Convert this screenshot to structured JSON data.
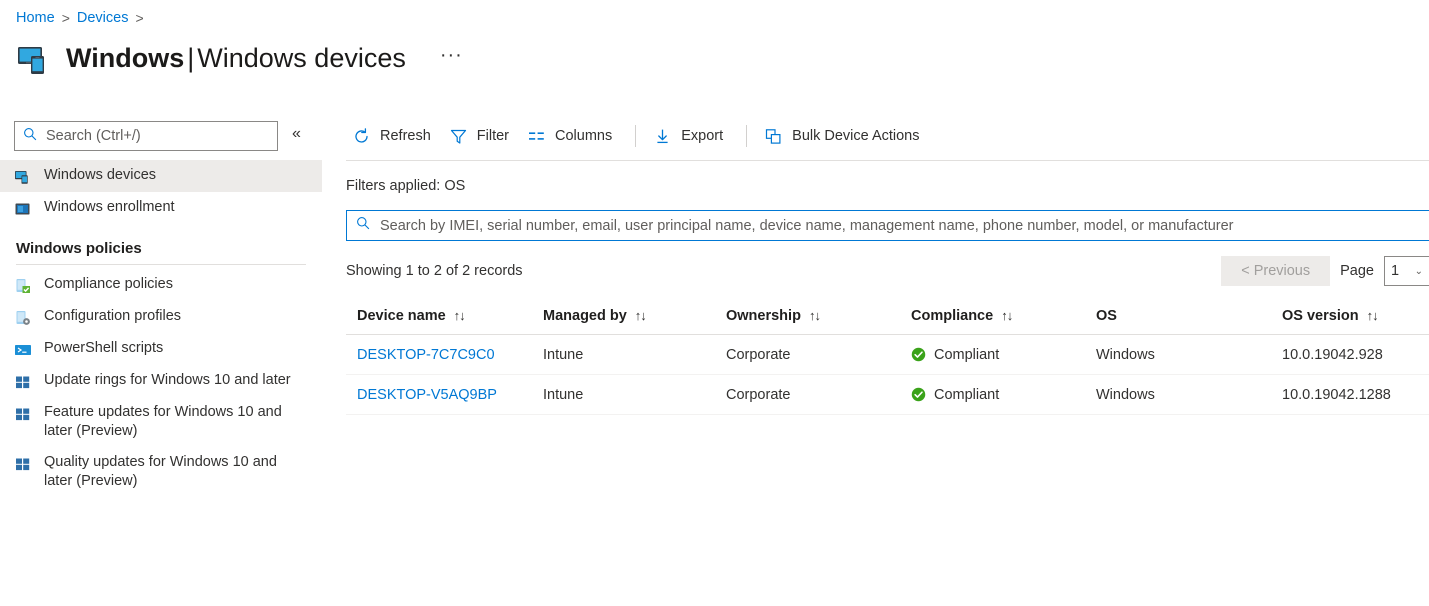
{
  "breadcrumb": {
    "items": [
      "Home",
      "Devices"
    ],
    "separator": ">"
  },
  "header": {
    "title_bold": "Windows",
    "title_separator": "|",
    "title_light": "Windows devices",
    "ellipsis": "···",
    "icon": "windows-devices-icon"
  },
  "sidebar": {
    "search": {
      "placeholder": "Search (Ctrl+/)",
      "value": "",
      "icon": "search-icon"
    },
    "collapse": {
      "icon": "chevron-double-left-icon",
      "glyph": "«"
    },
    "items": [
      {
        "label": "Windows devices",
        "icon": "windows-devices-icon",
        "selected": true
      },
      {
        "label": "Windows enrollment",
        "icon": "enrollment-screen-icon",
        "selected": false
      }
    ],
    "section_title": "Windows policies",
    "policy_items": [
      {
        "label": "Compliance policies",
        "icon": "device-check-icon"
      },
      {
        "label": "Configuration profiles",
        "icon": "device-gear-icon"
      },
      {
        "label": "PowerShell scripts",
        "icon": "powershell-icon"
      },
      {
        "label": "Update rings for Windows 10 and later",
        "icon": "windows-logo-icon"
      },
      {
        "label": "Feature updates for Windows 10 and later (Preview)",
        "icon": "windows-logo-icon"
      },
      {
        "label": "Quality updates for Windows 10 and later (Preview)",
        "icon": "windows-logo-icon"
      }
    ]
  },
  "toolbar": {
    "buttons": [
      {
        "label": "Refresh",
        "icon": "refresh-icon"
      },
      {
        "label": "Filter",
        "icon": "filter-icon"
      },
      {
        "label": "Columns",
        "icon": "columns-icon"
      },
      {
        "label": "Export",
        "icon": "export-download-icon"
      },
      {
        "label": "Bulk Device Actions",
        "icon": "bulk-actions-icon"
      }
    ]
  },
  "content": {
    "filters_applied": "Filters applied: OS",
    "table_search": {
      "placeholder": "Search by IMEI, serial number, email, user principal name, device name, management name, phone number, model, or manufacturer",
      "value": "",
      "icon": "search-icon"
    },
    "records_text": "Showing 1 to 2 of 2 records",
    "pager": {
      "previous_label": "< Previous",
      "previous_disabled": true,
      "page_label": "Page",
      "page_value": "1",
      "chevron": "⌄"
    }
  },
  "table": {
    "sort_glyph": "↑↓",
    "columns": [
      {
        "label": "Device name",
        "sortable": true
      },
      {
        "label": "Managed by",
        "sortable": true
      },
      {
        "label": "Ownership",
        "sortable": true
      },
      {
        "label": "Compliance",
        "sortable": true
      },
      {
        "label": "OS",
        "sortable": false
      },
      {
        "label": "OS version",
        "sortable": true
      }
    ],
    "rows": [
      {
        "device_name": "DESKTOP-7C7C9C0",
        "managed_by": "Intune",
        "ownership": "Corporate",
        "compliance": "Compliant",
        "compliance_icon": "compliant-check-icon",
        "os": "Windows",
        "os_version": "10.0.19042.928"
      },
      {
        "device_name": "DESKTOP-V5AQ9BP",
        "managed_by": "Intune",
        "ownership": "Corporate",
        "compliance": "Compliant",
        "compliance_icon": "compliant-check-icon",
        "os": "Windows",
        "os_version": "10.0.19042.1288"
      }
    ]
  },
  "colors": {
    "accent": "#0078d4",
    "link": "#0078d4",
    "compliant_green": "#3aa21a",
    "selected_bg": "#edebe9",
    "text": "#323130"
  }
}
